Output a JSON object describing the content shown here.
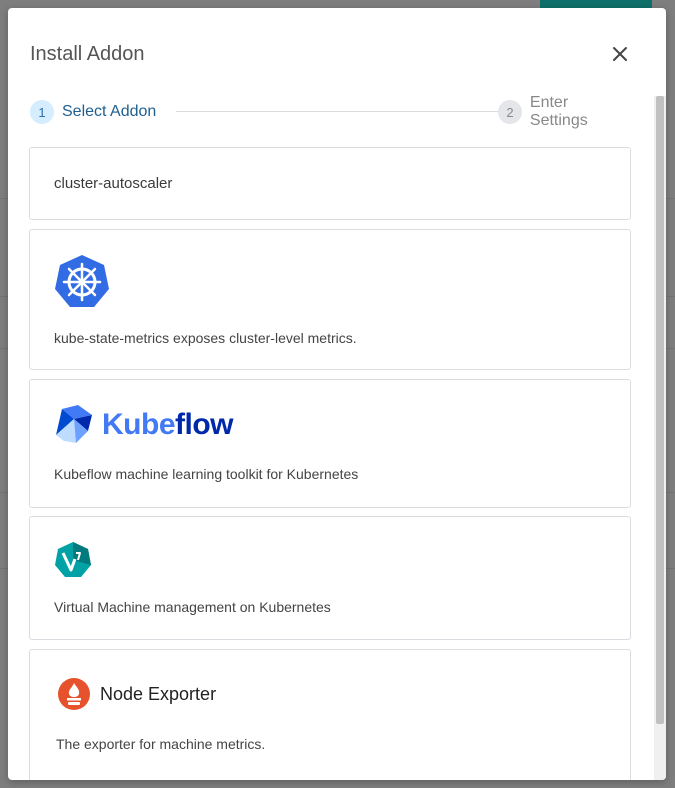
{
  "modal": {
    "title": "Install Addon",
    "close_icon": "close-icon"
  },
  "stepper": {
    "steps": [
      {
        "number": "1",
        "label": "Select Addon",
        "state": "active"
      },
      {
        "number": "2",
        "label": "Enter Settings",
        "state": "inactive"
      }
    ]
  },
  "addons": [
    {
      "name": "cluster-autoscaler",
      "description": "",
      "logo": "none"
    },
    {
      "name": "",
      "description": "kube-state-metrics exposes cluster-level metrics.",
      "logo": "kubernetes-helm-icon"
    },
    {
      "name": "Kubeflow",
      "description": "Kubeflow machine learning toolkit for Kubernetes",
      "logo": "kubeflow-logo"
    },
    {
      "name": "",
      "description": "Virtual Machine management on Kubernetes",
      "logo": "kubevirt-logo"
    },
    {
      "name": "Node Exporter",
      "description": "The exporter for machine metrics.",
      "logo": "prometheus-icon"
    }
  ],
  "colors": {
    "accent": "#2a6fb0",
    "kubernetes_blue": "#326ce5",
    "kubeflow_blue": "#4279f4",
    "kubevirt_teal": "#00a2a6",
    "prometheus_orange": "#e6522c",
    "background_teal": "#0f6f6a"
  }
}
